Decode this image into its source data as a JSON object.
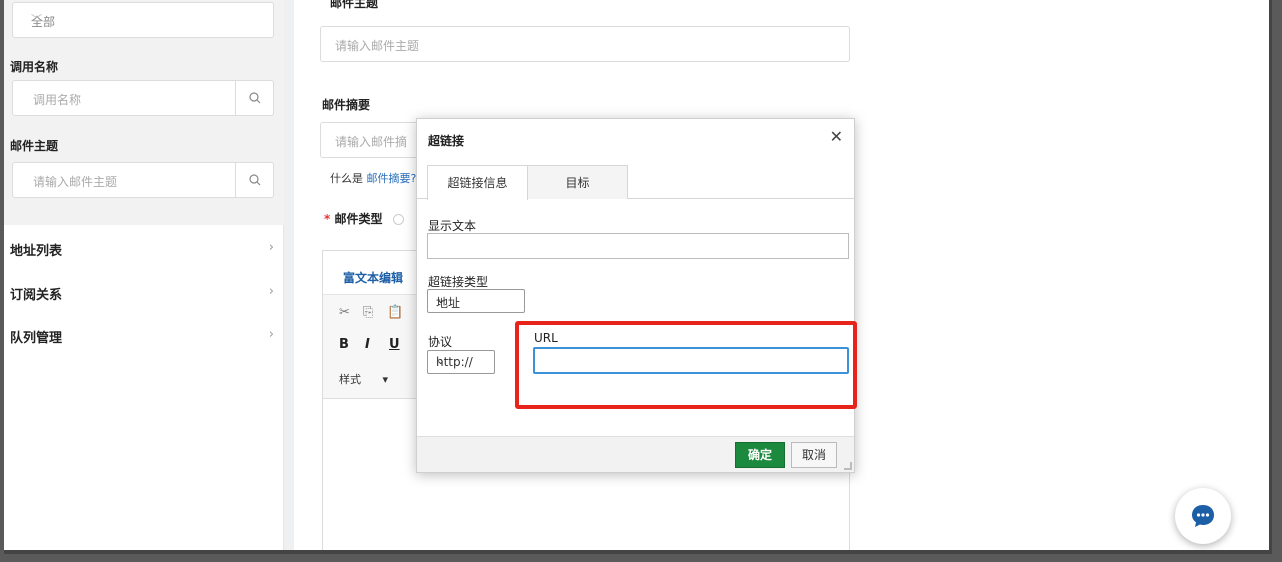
{
  "sidebar": {
    "scope_select": "全部",
    "call_name_label": "调用名称",
    "call_name_placeholder": "调用名称",
    "subject_label": "邮件主题",
    "subject_placeholder": "请输入邮件主题",
    "nav": [
      "地址列表",
      "订阅关系",
      "队列管理"
    ]
  },
  "main": {
    "subject_label": "邮件主题",
    "subject_placeholder": "请输入邮件主题",
    "summary_label": "邮件摘要",
    "summary_placeholder": "请输入邮件摘",
    "summary_help_prefix": "什么是",
    "summary_help_link": "邮件摘要?",
    "type_required": "*",
    "type_label": "邮件类型",
    "editor_tab": "富文本编辑",
    "style_label": "样式"
  },
  "dialog": {
    "title": "超链接",
    "tabs": [
      "超链接信息",
      "目标"
    ],
    "display_text_label": "显示文本",
    "display_text_value": "",
    "link_type_label": "超链接类型",
    "link_type_value": "地址",
    "protocol_label": "协议",
    "protocol_value": "http://",
    "url_label": "URL",
    "url_value": "",
    "ok_label": "确定",
    "cancel_label": "取消"
  },
  "colors": {
    "accent_blue": "#1d5fa6",
    "ok_green": "#1b8a3e",
    "highlight_red": "#e8231b",
    "focus_blue": "#3d91d8"
  },
  "icons": [
    "search-icon",
    "chevron-down-icon",
    "chevron-right-icon",
    "close-icon",
    "chat-icon",
    "cut-icon",
    "copy-icon",
    "paste-icon"
  ]
}
